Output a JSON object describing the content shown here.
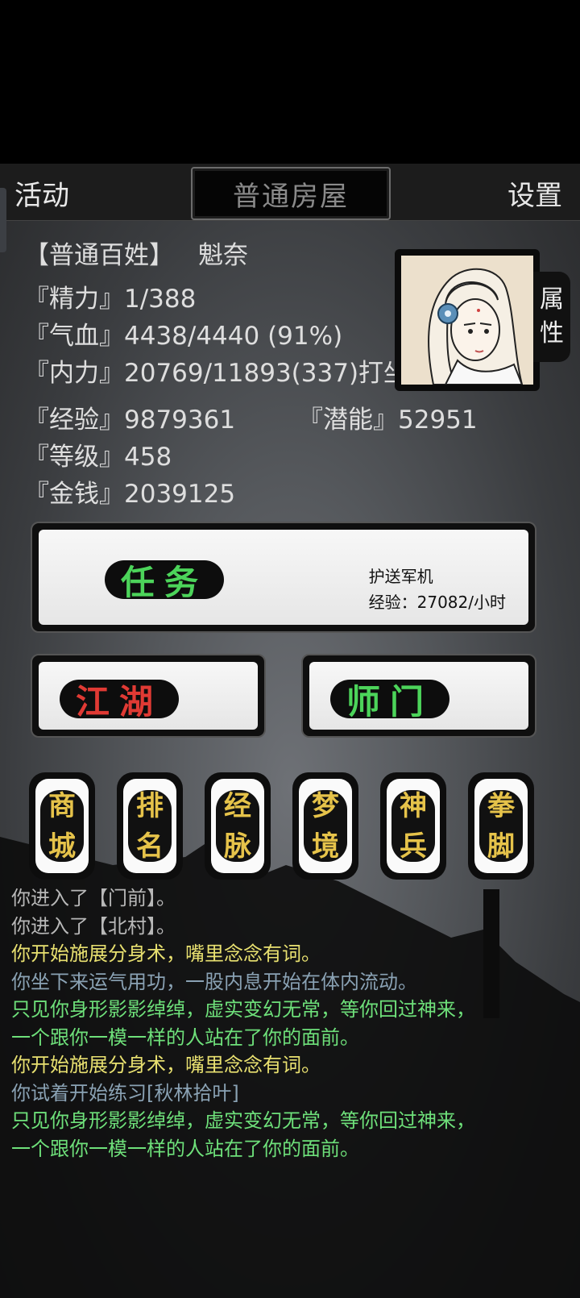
{
  "header": {
    "left_label": "活动",
    "location": "普通房屋",
    "right_label": "设置"
  },
  "player": {
    "title": "【普通百姓】",
    "name": "魁奈",
    "stamina": "『精力』1/388",
    "hp": "『气血』4438/4440 (91%)",
    "internal": "『内力』20769/11893(337)打坐",
    "exp": "『经验』9879361",
    "potential": "『潜能』52951",
    "level": "『等级』458",
    "money": "『金钱』2039125",
    "attr_tab": [
      "属",
      "性"
    ]
  },
  "task": {
    "label": "任务",
    "name": "护送军机",
    "exp_rate": "经验：27082/小时"
  },
  "buttons": {
    "jianghu": "江湖",
    "shimen": "师门"
  },
  "menu": [
    {
      "top": "商",
      "bottom": "城"
    },
    {
      "top": "排",
      "bottom": "名"
    },
    {
      "top": "经",
      "bottom": "脉"
    },
    {
      "top": "梦",
      "bottom": "境"
    },
    {
      "top": "神",
      "bottom": "兵"
    },
    {
      "top": "拳",
      "bottom": "脚"
    }
  ],
  "log": [
    {
      "text": "你进入了【门前】。",
      "color": "grey"
    },
    {
      "text": "你进入了【北村】。",
      "color": "grey"
    },
    {
      "text": "你开始施展分身术，嘴里念念有词。",
      "color": "yellow"
    },
    {
      "text": "你坐下来运气用功，一股内息开始在体内流动。",
      "color": "blue"
    },
    {
      "text": "只见你身形影影绰绰，虚实变幻无常，等你回过神来，",
      "color": "green"
    },
    {
      "text": "一个跟你一模一样的人站在了你的面前。",
      "color": "green"
    },
    {
      "text": "你开始施展分身术，嘴里念念有词。",
      "color": "yellow"
    },
    {
      "text": "你试着开始练习[秋林拾叶]",
      "color": "blue"
    },
    {
      "text": "只见你身形影影绰绰，虚实变幻无常，等你回过神来，",
      "color": "green"
    },
    {
      "text": "一个跟你一模一样的人站在了你的面前。",
      "color": "green"
    }
  ],
  "colors": {
    "task_label": "#4cd45a",
    "jianghu_label": "#e03a34",
    "shimen_label": "#4cd45a",
    "menu_label": "#e6c34a"
  }
}
